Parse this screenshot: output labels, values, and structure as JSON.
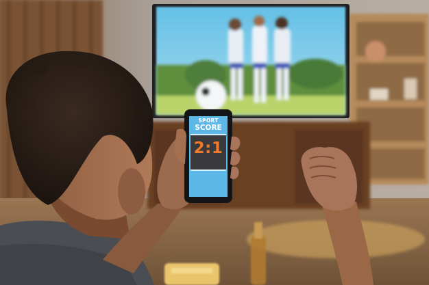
{
  "phone": {
    "sport_label": "SPORT",
    "score_label": "SCORE",
    "score_value": "2:1"
  },
  "colors": {
    "screen_blue": "#5db8e8",
    "score_orange": "#f07a2a",
    "panel_dark": "#3a3a3c",
    "tv_sky": "#6ec4e4",
    "tv_grass": "#b9d36a"
  }
}
